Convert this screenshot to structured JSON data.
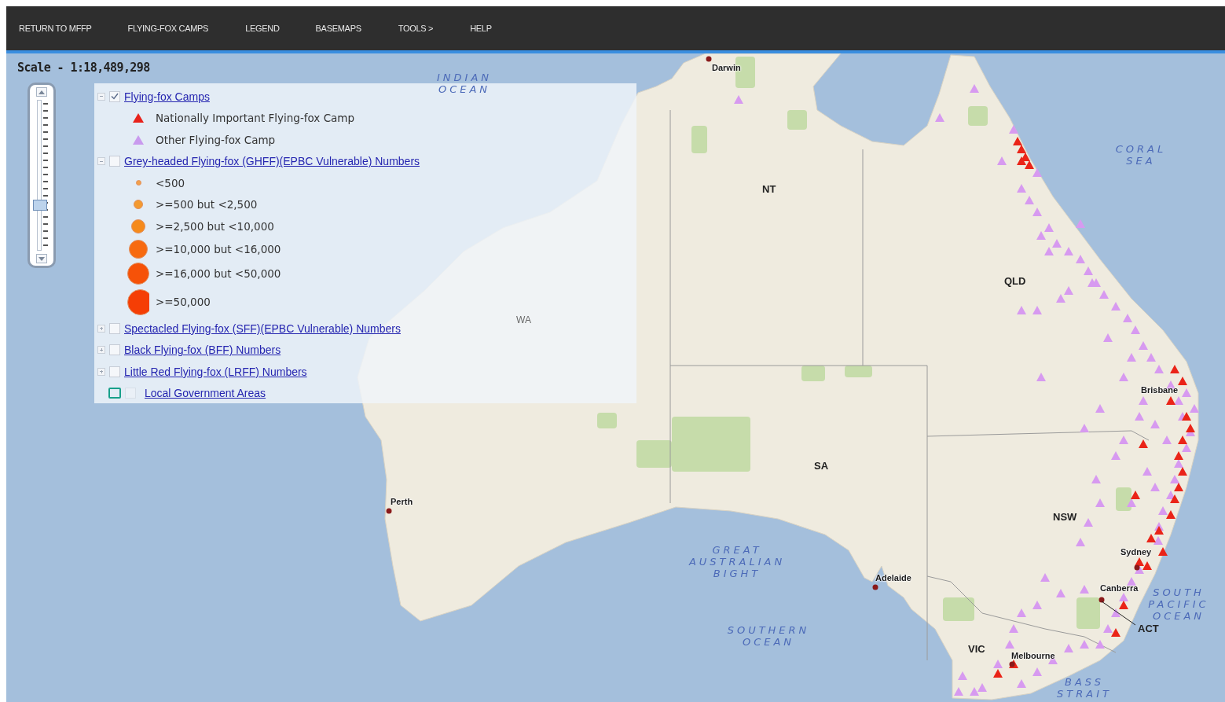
{
  "nav": [
    {
      "label": "RETURN TO MFFP"
    },
    {
      "label": "FLYING-FOX CAMPS"
    },
    {
      "label": "LEGEND"
    },
    {
      "label": "BASEMAPS"
    },
    {
      "label": "TOOLS >"
    },
    {
      "label": "HELP"
    }
  ],
  "scale": "Scale - 1:18,489,298",
  "zoom_slider": {
    "level": 0.3
  },
  "legend": {
    "layers": [
      {
        "kind": "group",
        "label": "Flying-fox Camps",
        "expanded": true,
        "checked": true,
        "children": [
          {
            "kind": "triangle",
            "label": "Nationally Important Flying-fox Camp",
            "color": "#e8221b"
          },
          {
            "kind": "triangle",
            "label": "Other Flying-fox Camp",
            "color": "#c99aee"
          }
        ]
      },
      {
        "kind": "group",
        "label": "Grey-headed Flying-fox (GHFF)(EPBC Vulnerable) Numbers",
        "expanded": true,
        "checked": false,
        "children": [
          {
            "kind": "circle",
            "label": "<500",
            "color": "#f3a04a"
          },
          {
            "kind": "circle",
            "label": ">=500 but <2,500",
            "color": "#f39a30"
          },
          {
            "kind": "circle",
            "label": ">=2,500 but <10,000",
            "color": "#f58a1c"
          },
          {
            "kind": "circle",
            "label": ">=10,000 but <16,000",
            "color": "#f76a10"
          },
          {
            "kind": "circle",
            "label": ">=16,000 but <50,000",
            "color": "#f65208"
          },
          {
            "kind": "circle",
            "label": ">=50,000",
            "color": "#f53e05"
          }
        ]
      },
      {
        "kind": "group",
        "label": "Spectacled Flying-fox (SFF)(EPBC Vulnerable) Numbers",
        "expanded": false,
        "checked": false
      },
      {
        "kind": "group",
        "label": "Black Flying-fox (BFF) Numbers",
        "expanded": false,
        "checked": false
      },
      {
        "kind": "group",
        "label": "Little Red Flying-fox (LRFF) Numbers",
        "expanded": false,
        "checked": false
      },
      {
        "kind": "area",
        "label": "Local Government Areas",
        "checked": false
      }
    ]
  },
  "map": {
    "labels": [
      {
        "kind": "sea",
        "lines": [
          "INDIAN",
          "OCEAN"
        ]
      },
      {
        "kind": "city",
        "text": "Darwin"
      },
      {
        "kind": "state",
        "text": "NT"
      },
      {
        "kind": "sea",
        "lines": [
          "CORAL",
          "SEA"
        ]
      },
      {
        "kind": "state",
        "text": "QLD"
      },
      {
        "kind": "region",
        "text": "WA"
      },
      {
        "kind": "city",
        "text": "Brisbane"
      },
      {
        "kind": "state",
        "text": "SA"
      },
      {
        "kind": "city",
        "text": "Perth"
      },
      {
        "kind": "state",
        "text": "NSW"
      },
      {
        "kind": "sea",
        "lines": [
          "GREAT",
          "AUSTRALIAN",
          "BIGHT"
        ]
      },
      {
        "kind": "city",
        "text": "Sydney"
      },
      {
        "kind": "city",
        "text": "Adelaide"
      },
      {
        "kind": "city",
        "text": "Canberra"
      },
      {
        "kind": "sea",
        "lines": [
          "SOUTH",
          "PACIFIC",
          "OCEAN"
        ]
      },
      {
        "kind": "state",
        "text": "ACT"
      },
      {
        "kind": "sea",
        "lines": [
          "SOUTHERN",
          "OCEAN"
        ]
      },
      {
        "kind": "state",
        "text": "VIC"
      },
      {
        "kind": "city",
        "text": "Melbourne"
      },
      {
        "kind": "sea",
        "lines": [
          "BASS",
          "STRAIT"
        ]
      }
    ]
  }
}
